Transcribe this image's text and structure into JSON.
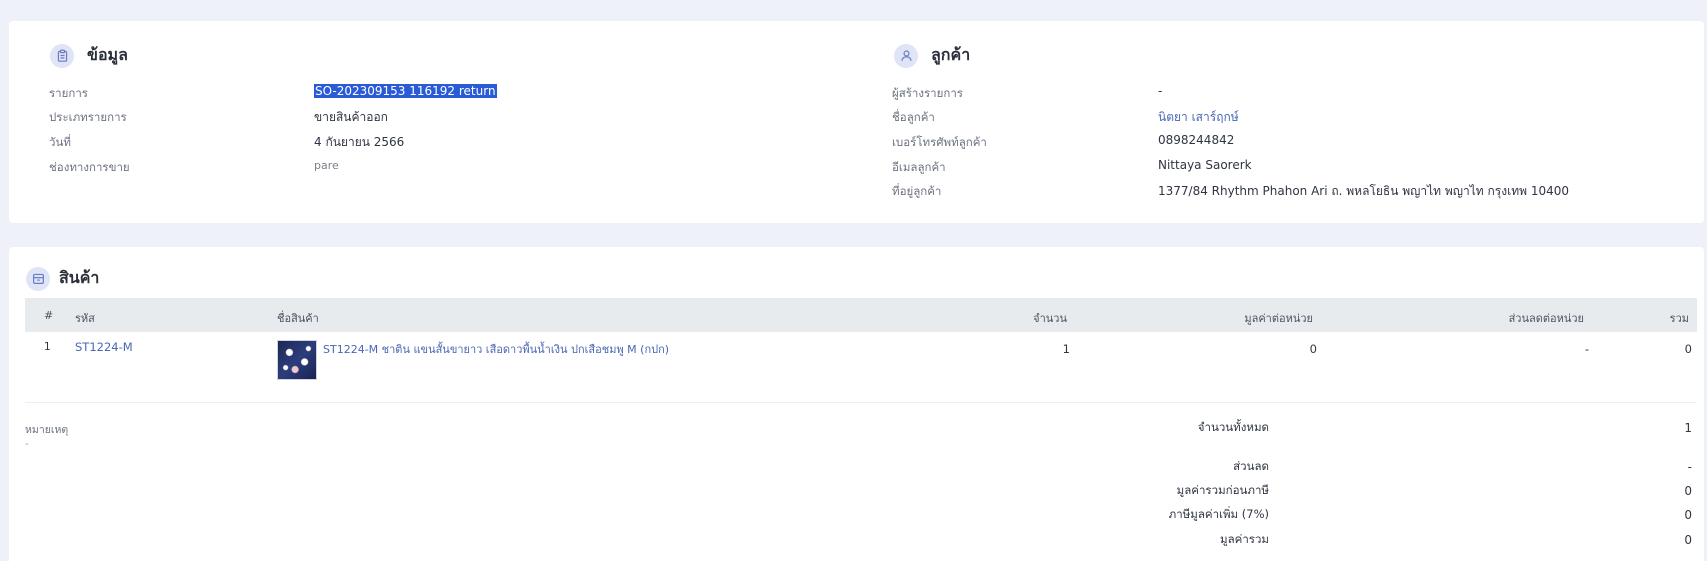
{
  "info": {
    "title": "ข้อมูล",
    "icon": "clipboard-icon",
    "fields": [
      {
        "label": "รายการ",
        "value": "SO-202309153 116192 return"
      },
      {
        "label": "ประเภทรายการ",
        "value": "ขายสินค้าออก"
      },
      {
        "label": "วันที่",
        "value": "4 กันยายน 2566"
      },
      {
        "label": "ช่องทางการขาย",
        "value": "pare"
      }
    ]
  },
  "customer": {
    "title": "ลูกค้า",
    "icon": "user-icon",
    "fields": [
      {
        "label": "ผู้สร้างรายการ",
        "value": "-"
      },
      {
        "label": "ชื่อลูกค้า",
        "value": "นิตยา เสาร์ฤกษ์"
      },
      {
        "label": "เบอร์โทรศัพท์ลูกค้า",
        "value": "0898244842"
      },
      {
        "label": "อีเมลลูกค้า",
        "value": "Nittaya Saorerk"
      },
      {
        "label": "ที่อยู่ลูกค้า",
        "value": "1377/84 Rhythm Phahon Ari ถ. พหลโยธิน พญาไท พญาไท กรุงเทพ 10400"
      }
    ]
  },
  "products": {
    "title": "สินค้า",
    "icon": "box-icon",
    "columns": {
      "index": "#",
      "code": "รหัส",
      "name": "ชื่อสินค้า",
      "qty": "จำนวน",
      "unit_price": "มูลค่าต่อหน่วย",
      "unit_discount": "ส่วนลดต่อหน่วย",
      "total": "รวม"
    },
    "rows": [
      {
        "index": "1",
        "code": "ST1224-M",
        "name": "ST1224-M ชาติน แขนสั้นขายาว เสือดาวพื้นน้ำเงิน ปกเสือชมพู M (กปก)",
        "qty": "1",
        "unit_price": "0",
        "unit_discount": "-",
        "total": "0"
      }
    ]
  },
  "note": {
    "label": "หมายเหตุ",
    "value": "-"
  },
  "summary": [
    {
      "label": "จำนวนทั้งหมด",
      "value": "1"
    },
    {
      "label": "ส่วนลด",
      "value": "-"
    },
    {
      "label": "มูลค่ารวมก่อนภาษี",
      "value": "0"
    },
    {
      "label": "ภาษีมูลค่าเพิ่ม (7%)",
      "value": "0"
    },
    {
      "label": "มูลค่ารวม",
      "value": "0"
    }
  ],
  "colors": {
    "background": "#eef1f8",
    "link": "#4a67b5",
    "selection": "#2a5bd7",
    "table_header": "#e8ebee"
  }
}
